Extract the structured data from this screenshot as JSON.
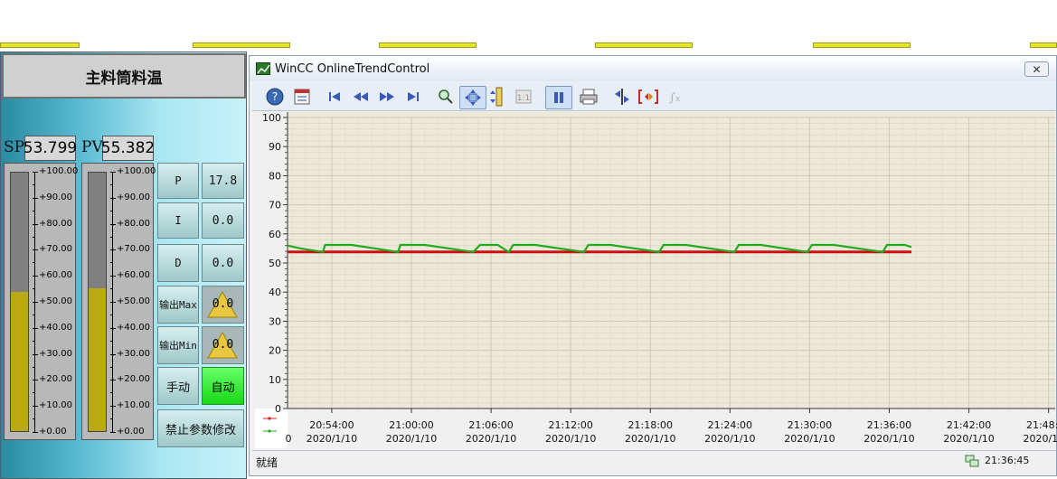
{
  "faceplate": {
    "title": "主料筒料温",
    "sp_label": "SP",
    "sp_value": "53.799",
    "pv_label": "PV",
    "pv_value": "55.382",
    "sp_bar_level_percent": 53.8,
    "pv_bar_level_percent": 55.4,
    "scale_labels": [
      "+100.00",
      "+90.00",
      "+80.00",
      "+70.00",
      "+60.00",
      "+50.00",
      "+40.00",
      "+30.00",
      "+20.00",
      "+10.00",
      "+0.00"
    ],
    "pid": [
      {
        "label": "P",
        "value": "17.8"
      },
      {
        "label": "I",
        "value": "0.0"
      },
      {
        "label": "D",
        "value": "0.0"
      },
      {
        "label": "输出Max",
        "value": "0.0"
      },
      {
        "label": "输出Min",
        "value": "0.0"
      }
    ],
    "manual_label": "手动",
    "auto_label": "自动",
    "lock_label": "禁止参数修改",
    "colors": {
      "bar_fill": "#b8aa10",
      "auto_active": "#22ee22"
    }
  },
  "trend": {
    "window_title": "WinCC OnlineTrendControl",
    "close_glyph": "✕",
    "status_text": "就绪",
    "status_time": "21:36:45",
    "toolbar_icons": [
      "help-icon",
      "config-icon",
      "first-icon",
      "rewind-icon",
      "forward-icon",
      "last-icon",
      "zoom-icon",
      "pan-icon",
      "ruler-icon",
      "original-view-icon",
      "pause-icon",
      "print-icon",
      "export-icon",
      "select-data-icon",
      "stats-icon"
    ],
    "legend_colors": [
      "#cc2020",
      "#22aa22"
    ]
  },
  "chart_data": {
    "type": "line",
    "ylim": [
      0,
      100
    ],
    "yticks": [
      "100",
      "90",
      "80",
      "70",
      "60",
      "50",
      "40",
      "30",
      "20",
      "10",
      "0"
    ],
    "x_tick_times": [
      "20:54:00",
      "21:00:00",
      "21:06:00",
      "21:12:00",
      "21:18:00",
      "21:24:00",
      "21:30:00",
      "21:36:00",
      "21:42:00",
      "21:48:00"
    ],
    "x_tick_date": "2020/1/10",
    "x_first_partial": "0",
    "xlim": [
      "20:50:40",
      "21:48:30"
    ],
    "series": [
      {
        "color": "#cc1010",
        "points": [
          [
            "20:50:40",
            53.8
          ],
          [
            "21:37:40",
            53.8
          ]
        ]
      },
      {
        "color": "#22aa22",
        "points": [
          [
            "20:50:40",
            56.0
          ],
          [
            "20:51:40",
            55.0
          ],
          [
            "20:53:20",
            53.8
          ],
          [
            "20:53:30",
            56.2
          ],
          [
            "20:55:30",
            56.2
          ],
          [
            "20:59:00",
            53.8
          ],
          [
            "20:59:10",
            56.2
          ],
          [
            "21:01:00",
            56.2
          ],
          [
            "21:04:40",
            53.8
          ],
          [
            "21:05:10",
            56.2
          ],
          [
            "21:06:30",
            56.2
          ],
          [
            "21:07:20",
            53.8
          ],
          [
            "21:07:40",
            56.2
          ],
          [
            "21:09:20",
            56.2
          ],
          [
            "21:13:00",
            53.8
          ],
          [
            "21:13:20",
            56.2
          ],
          [
            "21:15:00",
            56.2
          ],
          [
            "21:18:40",
            53.8
          ],
          [
            "21:19:00",
            56.2
          ],
          [
            "21:20:40",
            56.2
          ],
          [
            "21:24:20",
            53.8
          ],
          [
            "21:24:40",
            56.2
          ],
          [
            "21:26:20",
            56.2
          ],
          [
            "21:29:50",
            53.8
          ],
          [
            "21:30:10",
            56.2
          ],
          [
            "21:31:50",
            56.2
          ],
          [
            "21:35:30",
            53.8
          ],
          [
            "21:35:50",
            56.2
          ],
          [
            "21:37:10",
            56.2
          ],
          [
            "21:37:40",
            55.5
          ]
        ]
      }
    ]
  }
}
